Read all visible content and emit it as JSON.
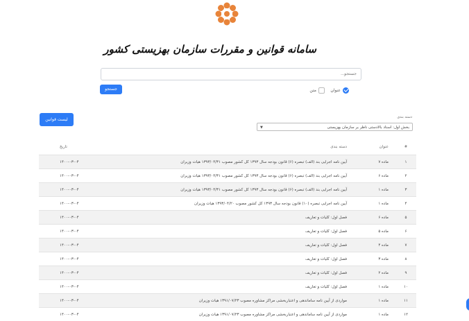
{
  "header": {
    "title": "سامانه قوانین و مقررات سازمان بهزیستی کشور"
  },
  "search": {
    "placeholder": "جستجو...",
    "option_title": "عنوان",
    "option_text": "متن",
    "button": "جستجو"
  },
  "laws_button": "لیست قوانین",
  "category": {
    "label": "دسته بندی",
    "selected": "بخش اول: اسناد بالادستی ناظر بر سازمان بهزیستی"
  },
  "table": {
    "headers": {
      "num": "#",
      "title": "عنوان",
      "category": "دسته بندی",
      "date": "تاریخ"
    },
    "rows": [
      {
        "num": "۱",
        "title": "ماده ۷",
        "category": "آیین نامه اجرایی بند (الف) تبصره (۶) قانون بودجه سال ۱۳۹۳ کل کشور مصوب ۱۳۹۳/۰۴/۳۱ هیات وزیران",
        "date": "۱۴۰۰-۰۳-۰۴"
      },
      {
        "num": "۲",
        "title": "ماده ۶",
        "category": "آیین نامه اجرایی بند (الف) تبصره (۶) قانون بودجه سال ۱۳۹۳ کل کشور مصوب ۱۳۹۳/۰۴/۳۱ هیات وزیران",
        "date": "۱۴۰۰-۰۳-۰۴"
      },
      {
        "num": "۳",
        "title": "ماده ۱",
        "category": "آیین نامه اجرایی بند (الف) تبصره (۶) قانون بودجه سال ۱۳۹۳ کل کشور مصوب ۱۳۹۳/۰۴/۳۱ هیات وزیران",
        "date": "۱۴۰۰-۰۳-۰۴"
      },
      {
        "num": "۴",
        "title": "ماده ۱",
        "category": "آیین نامه اجرایی تبصره (۱۰) قانون بودجه سال ۱۳۹۳ کل کشور مصوب ۱۳۹۳/۰۴/۲۰ هیات وزیران",
        "date": "۱۴۰۰-۰۳-۰۴"
      },
      {
        "num": "۵",
        "title": "ماده ۶",
        "category": "فصل اول: کلیات و تعاریف",
        "date": "۱۴۰۰-۰۳-۰۴"
      },
      {
        "num": "۶",
        "title": "ماده ۵",
        "category": "فصل اول: کلیات و تعاریف",
        "date": "۱۴۰۰-۰۳-۰۴"
      },
      {
        "num": "۷",
        "title": "ماده ۴",
        "category": "فصل اول: کلیات و تعاریف",
        "date": "۱۴۰۰-۰۳-۰۴"
      },
      {
        "num": "۸",
        "title": "ماده ۳",
        "category": "فصل اول: کلیات و تعاریف",
        "date": "۱۴۰۰-۰۳-۰۴"
      },
      {
        "num": "۹",
        "title": "ماده ۲",
        "category": "فصل اول: کلیات و تعاریف",
        "date": "۱۴۰۰-۰۳-۰۴"
      },
      {
        "num": "۱۰",
        "title": "ماده ۱",
        "category": "فصل اول: کلیات و تعاریف",
        "date": "۱۴۰۰-۰۳-۰۴"
      },
      {
        "num": "۱۱",
        "title": "ماده ۱",
        "category": "مواردی از آیین نامه ساماندهی و اعتباربخشی مراکز مشاوره مصوب ۱۳۹۱/۰۷/۲۳ هیات وزیران",
        "date": "۱۴۰۰-۰۳-۰۴"
      },
      {
        "num": "۱۲",
        "title": "ماده ۱",
        "category": "مواردی از آیین نامه ساماندهی و اعتباربخشی مراکز مشاوره مصوب ۱۳۹۱/۰۷/۲۳ هیات وزیران",
        "date": "۱۴۰۰-۰۳-۰۴"
      }
    ]
  },
  "colors": {
    "accent": "#2d7cf6",
    "logo": "#e8843a"
  }
}
